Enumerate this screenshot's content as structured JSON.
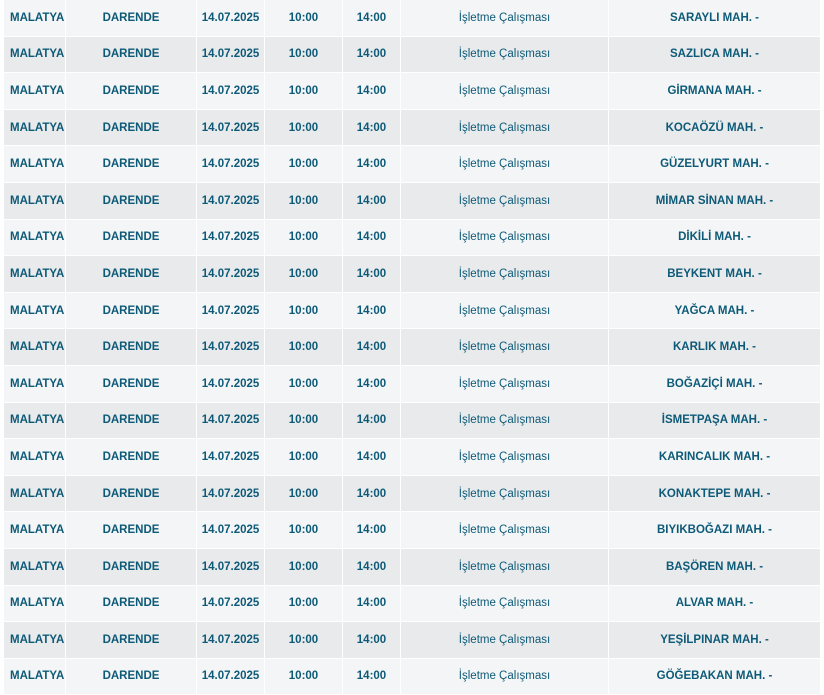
{
  "outage_table": {
    "rows": [
      {
        "il": "MALATYA",
        "ilce": "DARENDE",
        "tarih": "14.07.2025",
        "baslangic": "10:00",
        "bitis": "14:00",
        "neden": "İşletme Çalışması",
        "mahalle": "SARAYLI MAH. -"
      },
      {
        "il": "MALATYA",
        "ilce": "DARENDE",
        "tarih": "14.07.2025",
        "baslangic": "10:00",
        "bitis": "14:00",
        "neden": "İşletme Çalışması",
        "mahalle": "SAZLICA MAH. -"
      },
      {
        "il": "MALATYA",
        "ilce": "DARENDE",
        "tarih": "14.07.2025",
        "baslangic": "10:00",
        "bitis": "14:00",
        "neden": "İşletme Çalışması",
        "mahalle": "GİRMANA MAH. -"
      },
      {
        "il": "MALATYA",
        "ilce": "DARENDE",
        "tarih": "14.07.2025",
        "baslangic": "10:00",
        "bitis": "14:00",
        "neden": "İşletme Çalışması",
        "mahalle": "KOCAÖZÜ MAH. -"
      },
      {
        "il": "MALATYA",
        "ilce": "DARENDE",
        "tarih": "14.07.2025",
        "baslangic": "10:00",
        "bitis": "14:00",
        "neden": "İşletme Çalışması",
        "mahalle": "GÜZELYURT MAH. -"
      },
      {
        "il": "MALATYA",
        "ilce": "DARENDE",
        "tarih": "14.07.2025",
        "baslangic": "10:00",
        "bitis": "14:00",
        "neden": "İşletme Çalışması",
        "mahalle": "MİMAR SİNAN MAH. -"
      },
      {
        "il": "MALATYA",
        "ilce": "DARENDE",
        "tarih": "14.07.2025",
        "baslangic": "10:00",
        "bitis": "14:00",
        "neden": "İşletme Çalışması",
        "mahalle": "DİKİLİ MAH. -"
      },
      {
        "il": "MALATYA",
        "ilce": "DARENDE",
        "tarih": "14.07.2025",
        "baslangic": "10:00",
        "bitis": "14:00",
        "neden": "İşletme Çalışması",
        "mahalle": "BEYKENT MAH. -"
      },
      {
        "il": "MALATYA",
        "ilce": "DARENDE",
        "tarih": "14.07.2025",
        "baslangic": "10:00",
        "bitis": "14:00",
        "neden": "İşletme Çalışması",
        "mahalle": "YAĞCA MAH. -"
      },
      {
        "il": "MALATYA",
        "ilce": "DARENDE",
        "tarih": "14.07.2025",
        "baslangic": "10:00",
        "bitis": "14:00",
        "neden": "İşletme Çalışması",
        "mahalle": "KARLIK MAH. -"
      },
      {
        "il": "MALATYA",
        "ilce": "DARENDE",
        "tarih": "14.07.2025",
        "baslangic": "10:00",
        "bitis": "14:00",
        "neden": "İşletme Çalışması",
        "mahalle": "BOĞAZİÇİ MAH. -"
      },
      {
        "il": "MALATYA",
        "ilce": "DARENDE",
        "tarih": "14.07.2025",
        "baslangic": "10:00",
        "bitis": "14:00",
        "neden": "İşletme Çalışması",
        "mahalle": "İSMETPAŞA MAH. -"
      },
      {
        "il": "MALATYA",
        "ilce": "DARENDE",
        "tarih": "14.07.2025",
        "baslangic": "10:00",
        "bitis": "14:00",
        "neden": "İşletme Çalışması",
        "mahalle": "KARINCALIK MAH. -"
      },
      {
        "il": "MALATYA",
        "ilce": "DARENDE",
        "tarih": "14.07.2025",
        "baslangic": "10:00",
        "bitis": "14:00",
        "neden": "İşletme Çalışması",
        "mahalle": "KONAKTEPE MAH. -"
      },
      {
        "il": "MALATYA",
        "ilce": "DARENDE",
        "tarih": "14.07.2025",
        "baslangic": "10:00",
        "bitis": "14:00",
        "neden": "İşletme Çalışması",
        "mahalle": "BIYIKBOĞAZI MAH. -"
      },
      {
        "il": "MALATYA",
        "ilce": "DARENDE",
        "tarih": "14.07.2025",
        "baslangic": "10:00",
        "bitis": "14:00",
        "neden": "İşletme Çalışması",
        "mahalle": "BAŞÖREN MAH. -"
      },
      {
        "il": "MALATYA",
        "ilce": "DARENDE",
        "tarih": "14.07.2025",
        "baslangic": "10:00",
        "bitis": "14:00",
        "neden": "İşletme Çalışması",
        "mahalle": "ALVAR MAH. -"
      },
      {
        "il": "MALATYA",
        "ilce": "DARENDE",
        "tarih": "14.07.2025",
        "baslangic": "10:00",
        "bitis": "14:00",
        "neden": "İşletme Çalışması",
        "mahalle": "YEŞİLPINAR MAH. -"
      },
      {
        "il": "MALATYA",
        "ilce": "DARENDE",
        "tarih": "14.07.2025",
        "baslangic": "10:00",
        "bitis": "14:00",
        "neden": "İşletme Çalışması",
        "mahalle": "GÖĞEBAKAN MAH. -"
      }
    ]
  },
  "colors": {
    "text": "#0d5a78",
    "row_light": "#f4f5f6",
    "row_dark": "#e9eaeb"
  }
}
